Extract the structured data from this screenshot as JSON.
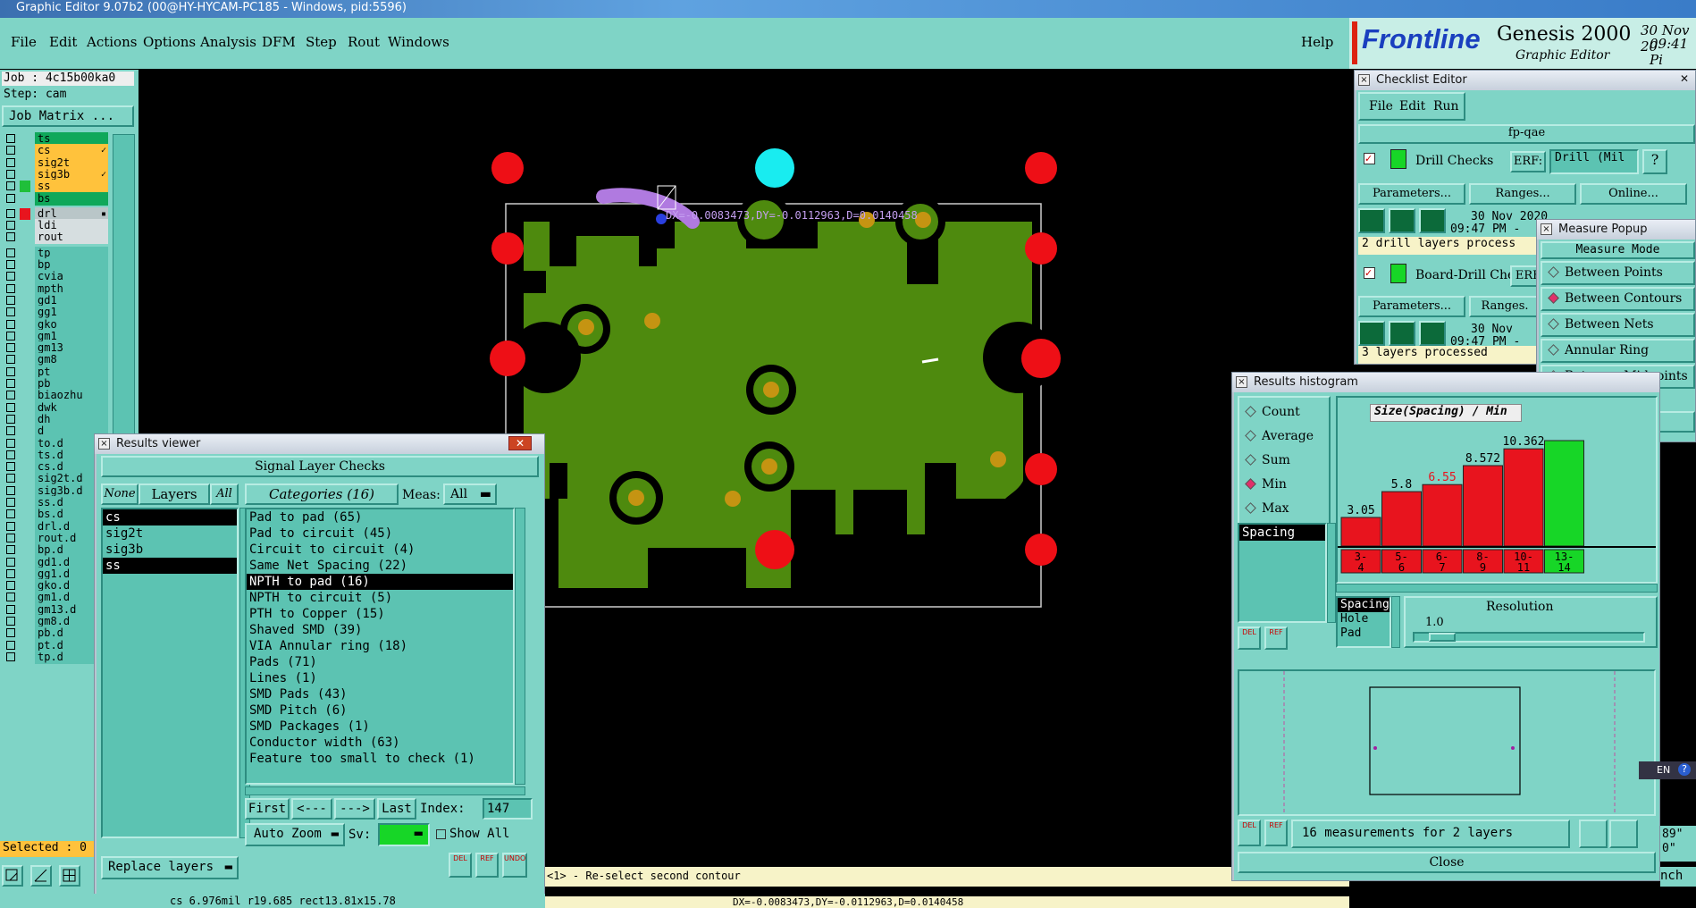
{
  "window_title": "Graphic Editor 9.07b2 (00@HY-HYCAM-PC185 - Windows, pid:5596)",
  "menu": [
    "File",
    "Edit",
    "Actions",
    "Options",
    "Analysis",
    "DFM",
    "Step",
    "Rout",
    "Windows"
  ],
  "help": "Help",
  "logo": {
    "brand": "Frontline",
    "product": "Genesis 2000",
    "subtitle": "Graphic Editor",
    "date": "30 Nov 20",
    "time": "09:41 Pi"
  },
  "job": {
    "job": "Job : 4c15b00ka0",
    "step": "Step: cam",
    "matrix_btn": "Job Matrix ..."
  },
  "layers_top": [
    {
      "name": "ts",
      "color": "#0fa85a"
    },
    {
      "name": "cs",
      "color": "#ffc23c",
      "mark": "✓"
    },
    {
      "name": "sig2t",
      "color": "#ffc23c"
    },
    {
      "name": "sig3b",
      "color": "#ffc23c",
      "mark": "✓"
    },
    {
      "name": "ss",
      "color": "#ffc23c",
      "marker": "#1fbf3a"
    },
    {
      "name": "bs",
      "color": "#0fa85a"
    }
  ],
  "layers_mid": [
    {
      "name": "drl",
      "color": "#b9c6c8",
      "marker": "#e8141e",
      "mark": "▪"
    },
    {
      "name": "ldi",
      "color": "#d6dee0"
    },
    {
      "name": "rout",
      "color": "#d6dee0"
    }
  ],
  "layers_doc": [
    "tp",
    "bp",
    "cvia",
    "mpth",
    "gd1",
    "gg1",
    "gko",
    "gm1",
    "gm13",
    "gm8",
    "pt",
    "pb",
    "biaozhu",
    "dwk",
    "dh",
    "d",
    "to.d",
    "ts.d",
    "cs.d",
    "sig2t.d",
    "sig3b.d",
    "ss.d",
    "bs.d",
    "drl.d",
    "rout.d",
    "bp.d",
    "gd1.d",
    "gg1.d",
    "gko.d",
    "gm1.d",
    "gm13.d",
    "gm8.d",
    "pb.d",
    "pt.d",
    "tp.d"
  ],
  "selected": "Selected : 0",
  "measure_text": "DX=-0.0083473,DY=-0.0112963,D=0.0140458",
  "status_prompt": "<1> - Re-select second contour",
  "status_coords": "DX=-0.0083473,DY=-0.0112963,D=0.0140458",
  "status_layer": "cs 6.976mil  r19.685  rect13.81x15.78",
  "results_viewer": {
    "title": "Results viewer",
    "header": "Signal Layer Checks",
    "none": "None",
    "layers": "Layers",
    "all": "All",
    "categories_label": "Categories (16)",
    "meas_label": "Meas:",
    "meas_value": "All",
    "layer_list": [
      "cs",
      "sig2t",
      "sig3b",
      "ss"
    ],
    "categories": [
      "Pad to pad (65)",
      "Pad to circuit (45)",
      "Circuit to circuit (4)",
      "Same Net Spacing (22)",
      "NPTH to pad (16)",
      "NPTH to circuit (5)",
      "PTH to Copper (15)",
      "Shaved SMD (39)",
      "VIA Annular ring (18)",
      "Pads (71)",
      "Lines (1)",
      "SMD Pads (43)",
      "SMD Pitch (6)",
      "SMD Packages (1)",
      "Conductor width (63)",
      "Feature too small to check (1)"
    ],
    "first": "First",
    "prev": "<---",
    "next": "--->",
    "last": "Last",
    "index_label": "Index:",
    "index_value": "147",
    "autozoom": "Auto Zoom",
    "sv": "Sv:",
    "show_all": "Show All",
    "replace": "Replace layers",
    "del": "DEL",
    "ref": "REF",
    "undo": "UNDO"
  },
  "checklist": {
    "title": "Checklist Editor",
    "menu": [
      "File",
      "Edit",
      "Run"
    ],
    "name": "fp-qae",
    "check1": {
      "name": "Drill Checks",
      "erf": "ERF:",
      "erf_value": "Drill (Mil",
      "help": "?",
      "params": "Parameters...",
      "ranges": "Ranges...",
      "online": "Online...",
      "date": "30 Nov 2020",
      "time": "09:47 PM -",
      "status": "2 drill layers process"
    },
    "check2": {
      "name": "Board-Drill Che",
      "erf": "ERF",
      "params": "Parameters...",
      "ranges": "Ranges.",
      "date": "30 Nov",
      "time": "09:47 PM -",
      "status": "3 layers processed"
    }
  },
  "measure_popup": {
    "title": "Measure Popup",
    "header": "Measure Mode",
    "modes": [
      "Between Points",
      "Between Contours",
      "Between Nets",
      "Annular Ring",
      "Between Midpoints"
    ],
    "selected": 1,
    "close": "Close"
  },
  "histogram": {
    "title": "Results histogram",
    "stats": [
      "Count",
      "Average",
      "Sum",
      "Min",
      "Max"
    ],
    "selected_stat": 3,
    "chart_title": "Size(Spacing) / Min",
    "list1": [
      "Spacing"
    ],
    "list2": [
      "Spacing",
      "Hole",
      "Pad"
    ],
    "resolution_label": "Resolution",
    "resolution_value": "1.0",
    "footer": "16 measurements for 2 layers",
    "close": "Close",
    "del": "DEL",
    "ref": "REF"
  },
  "chart_data": {
    "type": "bar",
    "title": "Size(Spacing) / Min",
    "categories": [
      "3-4",
      "5-6",
      "6-7",
      "8-9",
      "10-11",
      "13-14"
    ],
    "values": [
      3.05,
      5.8,
      6.55,
      8.572,
      10.362,
      null
    ],
    "labels": [
      "3.05",
      "5.8",
      "6.55",
      "8.572",
      "10.362",
      ""
    ],
    "colors": [
      "#e8141e",
      "#e8141e",
      "#e8141e",
      "#e8141e",
      "#e8141e",
      "#17d627"
    ],
    "highlight_label_color": "#e8141e"
  },
  "tray": {
    "lang": "EN",
    "help": "?",
    "t1": "89\"",
    "t2": "0\"",
    "bench": "nch"
  }
}
